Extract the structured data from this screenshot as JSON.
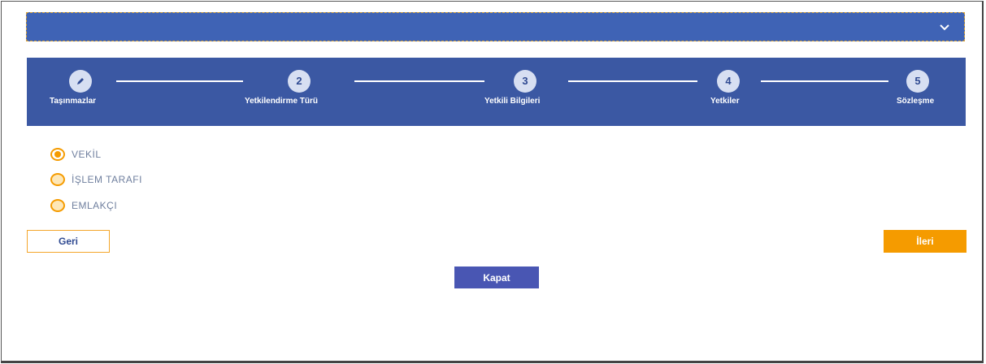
{
  "header": {
    "dropdown_icon": "chevron-down-icon",
    "chevron": "⌄"
  },
  "stepper": {
    "steps": [
      {
        "number": "",
        "icon": "pencil-icon",
        "label": "Taşınmazlar",
        "completed": true
      },
      {
        "number": "2",
        "label": "Yetkilendirme Türü"
      },
      {
        "number": "3",
        "label": "Yetkili Bilgileri"
      },
      {
        "number": "4",
        "label": "Yetkiler"
      },
      {
        "number": "5",
        "label": "Sözleşme"
      }
    ]
  },
  "options": [
    {
      "label": "VEKİL",
      "selected": true
    },
    {
      "label": "İŞLEM TARAFI",
      "selected": false
    },
    {
      "label": "EMLAKÇI",
      "selected": false
    }
  ],
  "buttons": {
    "back": "Geri",
    "next": "İleri",
    "close": "Kapat"
  },
  "colors": {
    "primary": "#3b58a3",
    "accent": "#f59b00",
    "close": "#4956b3"
  }
}
